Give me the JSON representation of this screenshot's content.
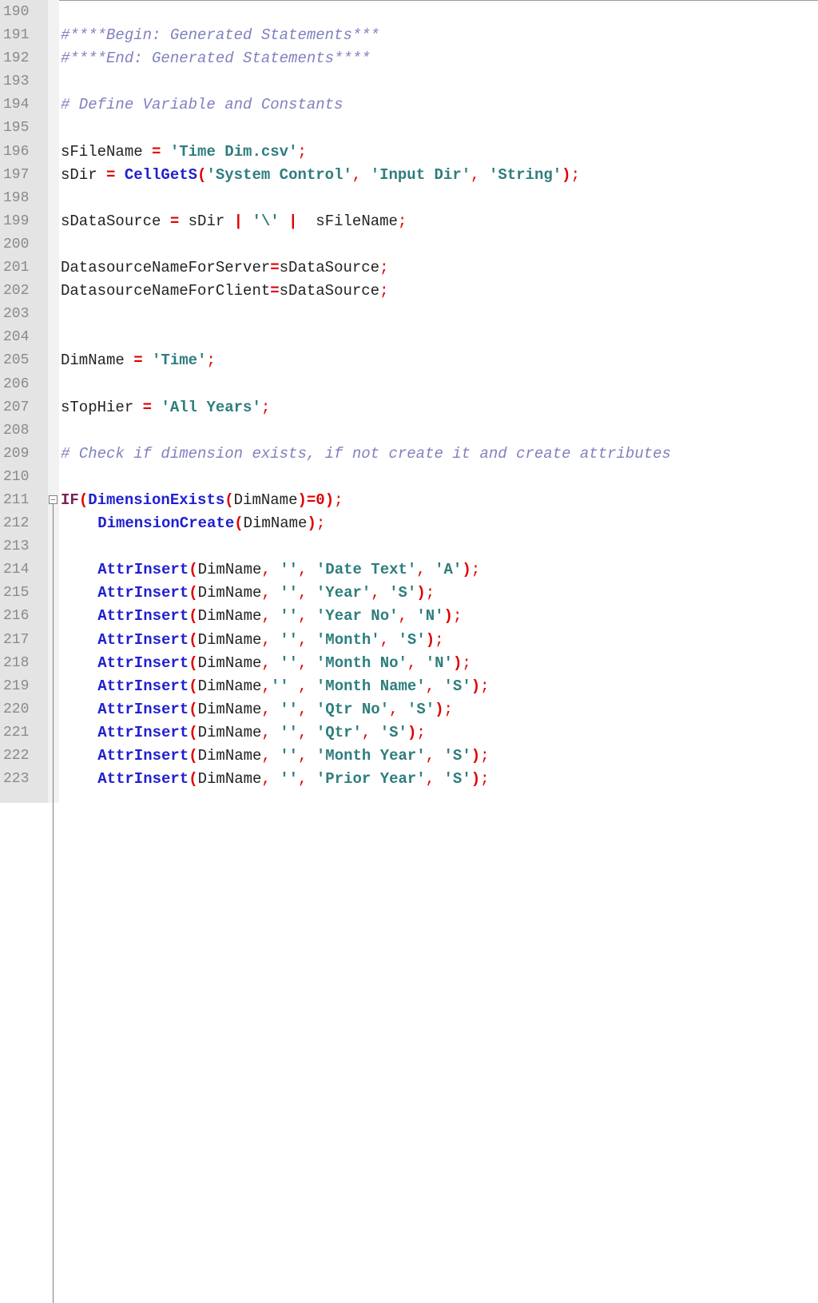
{
  "editor": {
    "lines": [
      {
        "num": "190",
        "indent": 0,
        "tokens": []
      },
      {
        "num": "191",
        "indent": 0,
        "tokens": [
          {
            "t": "comment",
            "v": "#****Begin: Generated Statements***"
          }
        ]
      },
      {
        "num": "192",
        "indent": 0,
        "tokens": [
          {
            "t": "comment",
            "v": "#****End: Generated Statements****"
          }
        ]
      },
      {
        "num": "193",
        "indent": 0,
        "tokens": []
      },
      {
        "num": "194",
        "indent": 0,
        "tokens": [
          {
            "t": "comment",
            "v": "# Define Variable and Constants"
          }
        ]
      },
      {
        "num": "195",
        "indent": 0,
        "tokens": []
      },
      {
        "num": "196",
        "indent": 0,
        "tokens": [
          {
            "t": "ident",
            "v": "sFileName "
          },
          {
            "t": "op",
            "v": "="
          },
          {
            "t": "space",
            "v": " "
          },
          {
            "t": "str",
            "v": "'Time Dim.csv'"
          },
          {
            "t": "punct",
            "v": ";"
          }
        ]
      },
      {
        "num": "197",
        "indent": 0,
        "tokens": [
          {
            "t": "ident",
            "v": "sDir "
          },
          {
            "t": "op",
            "v": "="
          },
          {
            "t": "space",
            "v": " "
          },
          {
            "t": "func",
            "v": "CellGetS"
          },
          {
            "t": "op",
            "v": "("
          },
          {
            "t": "str",
            "v": "'System Control'"
          },
          {
            "t": "punct",
            "v": ", "
          },
          {
            "t": "str",
            "v": "'Input Dir'"
          },
          {
            "t": "punct",
            "v": ", "
          },
          {
            "t": "str",
            "v": "'String'"
          },
          {
            "t": "op",
            "v": ")"
          },
          {
            "t": "punct",
            "v": ";"
          }
        ]
      },
      {
        "num": "198",
        "indent": 0,
        "tokens": []
      },
      {
        "num": "199",
        "indent": 0,
        "tokens": [
          {
            "t": "ident",
            "v": "sDataSource "
          },
          {
            "t": "op",
            "v": "="
          },
          {
            "t": "ident",
            "v": " sDir "
          },
          {
            "t": "op",
            "v": "|"
          },
          {
            "t": "space",
            "v": " "
          },
          {
            "t": "str",
            "v": "'\\'"
          },
          {
            "t": "space",
            "v": " "
          },
          {
            "t": "op",
            "v": "|"
          },
          {
            "t": "ident",
            "v": "  sFileName"
          },
          {
            "t": "punct",
            "v": ";"
          }
        ]
      },
      {
        "num": "200",
        "indent": 0,
        "tokens": []
      },
      {
        "num": "201",
        "indent": 0,
        "tokens": [
          {
            "t": "ident",
            "v": "DatasourceNameForServer"
          },
          {
            "t": "op",
            "v": "="
          },
          {
            "t": "ident",
            "v": "sDataSource"
          },
          {
            "t": "punct",
            "v": ";"
          }
        ]
      },
      {
        "num": "202",
        "indent": 0,
        "tokens": [
          {
            "t": "ident",
            "v": "DatasourceNameForClient"
          },
          {
            "t": "op",
            "v": "="
          },
          {
            "t": "ident",
            "v": "sDataSource"
          },
          {
            "t": "punct",
            "v": ";"
          }
        ]
      },
      {
        "num": "203",
        "indent": 0,
        "tokens": []
      },
      {
        "num": "204",
        "indent": 0,
        "tokens": []
      },
      {
        "num": "205",
        "indent": 0,
        "tokens": [
          {
            "t": "ident",
            "v": "DimName "
          },
          {
            "t": "op",
            "v": "="
          },
          {
            "t": "space",
            "v": " "
          },
          {
            "t": "str",
            "v": "'Time'"
          },
          {
            "t": "punct",
            "v": ";"
          }
        ]
      },
      {
        "num": "206",
        "indent": 0,
        "tokens": []
      },
      {
        "num": "207",
        "indent": 0,
        "tokens": [
          {
            "t": "ident",
            "v": "sTopHier "
          },
          {
            "t": "op",
            "v": "="
          },
          {
            "t": "space",
            "v": " "
          },
          {
            "t": "str",
            "v": "'All Years'"
          },
          {
            "t": "punct",
            "v": ";"
          }
        ]
      },
      {
        "num": "208",
        "indent": 0,
        "tokens": []
      },
      {
        "num": "209",
        "indent": 0,
        "tokens": [
          {
            "t": "comment",
            "v": "# Check if dimension exists, if not create it and create attributes"
          }
        ]
      },
      {
        "num": "210",
        "indent": 0,
        "tokens": []
      },
      {
        "num": "211",
        "indent": 0,
        "fold": true,
        "tokens": [
          {
            "t": "kw",
            "v": "IF"
          },
          {
            "t": "op",
            "v": "("
          },
          {
            "t": "func",
            "v": "DimensionExists"
          },
          {
            "t": "op",
            "v": "("
          },
          {
            "t": "ident",
            "v": "DimName"
          },
          {
            "t": "op",
            "v": ")=0)"
          },
          {
            "t": "punct",
            "v": ";"
          }
        ]
      },
      {
        "num": "212",
        "indent": 4,
        "tokens": [
          {
            "t": "func",
            "v": "DimensionCreate"
          },
          {
            "t": "op",
            "v": "("
          },
          {
            "t": "ident",
            "v": "DimName"
          },
          {
            "t": "op",
            "v": ")"
          },
          {
            "t": "punct",
            "v": ";"
          }
        ]
      },
      {
        "num": "213",
        "indent": 0,
        "tokens": []
      },
      {
        "num": "214",
        "indent": 4,
        "tokens": [
          {
            "t": "func",
            "v": "AttrInsert"
          },
          {
            "t": "op",
            "v": "("
          },
          {
            "t": "ident",
            "v": "DimName"
          },
          {
            "t": "punct",
            "v": ", "
          },
          {
            "t": "str",
            "v": "''"
          },
          {
            "t": "punct",
            "v": ", "
          },
          {
            "t": "str",
            "v": "'Date Text'"
          },
          {
            "t": "punct",
            "v": ", "
          },
          {
            "t": "str",
            "v": "'A'"
          },
          {
            "t": "op",
            "v": ")"
          },
          {
            "t": "punct",
            "v": ";"
          }
        ]
      },
      {
        "num": "215",
        "indent": 4,
        "tokens": [
          {
            "t": "func",
            "v": "AttrInsert"
          },
          {
            "t": "op",
            "v": "("
          },
          {
            "t": "ident",
            "v": "DimName"
          },
          {
            "t": "punct",
            "v": ", "
          },
          {
            "t": "str",
            "v": "''"
          },
          {
            "t": "punct",
            "v": ", "
          },
          {
            "t": "str",
            "v": "'Year'"
          },
          {
            "t": "punct",
            "v": ", "
          },
          {
            "t": "str",
            "v": "'S'"
          },
          {
            "t": "op",
            "v": ")"
          },
          {
            "t": "punct",
            "v": ";"
          }
        ]
      },
      {
        "num": "216",
        "indent": 4,
        "tokens": [
          {
            "t": "func",
            "v": "AttrInsert"
          },
          {
            "t": "op",
            "v": "("
          },
          {
            "t": "ident",
            "v": "DimName"
          },
          {
            "t": "punct",
            "v": ", "
          },
          {
            "t": "str",
            "v": "''"
          },
          {
            "t": "punct",
            "v": ", "
          },
          {
            "t": "str",
            "v": "'Year No'"
          },
          {
            "t": "punct",
            "v": ", "
          },
          {
            "t": "str",
            "v": "'N'"
          },
          {
            "t": "op",
            "v": ")"
          },
          {
            "t": "punct",
            "v": ";"
          }
        ]
      },
      {
        "num": "217",
        "indent": 4,
        "tokens": [
          {
            "t": "func",
            "v": "AttrInsert"
          },
          {
            "t": "op",
            "v": "("
          },
          {
            "t": "ident",
            "v": "DimName"
          },
          {
            "t": "punct",
            "v": ", "
          },
          {
            "t": "str",
            "v": "''"
          },
          {
            "t": "punct",
            "v": ", "
          },
          {
            "t": "str",
            "v": "'Month'"
          },
          {
            "t": "punct",
            "v": ", "
          },
          {
            "t": "str",
            "v": "'S'"
          },
          {
            "t": "op",
            "v": ")"
          },
          {
            "t": "punct",
            "v": ";"
          }
        ]
      },
      {
        "num": "218",
        "indent": 4,
        "tokens": [
          {
            "t": "func",
            "v": "AttrInsert"
          },
          {
            "t": "op",
            "v": "("
          },
          {
            "t": "ident",
            "v": "DimName"
          },
          {
            "t": "punct",
            "v": ", "
          },
          {
            "t": "str",
            "v": "''"
          },
          {
            "t": "punct",
            "v": ", "
          },
          {
            "t": "str",
            "v": "'Month No'"
          },
          {
            "t": "punct",
            "v": ", "
          },
          {
            "t": "str",
            "v": "'N'"
          },
          {
            "t": "op",
            "v": ")"
          },
          {
            "t": "punct",
            "v": ";"
          }
        ]
      },
      {
        "num": "219",
        "indent": 4,
        "tokens": [
          {
            "t": "func",
            "v": "AttrInsert"
          },
          {
            "t": "op",
            "v": "("
          },
          {
            "t": "ident",
            "v": "DimName"
          },
          {
            "t": "punct",
            "v": ","
          },
          {
            "t": "str",
            "v": "''"
          },
          {
            "t": "punct",
            "v": " , "
          },
          {
            "t": "str",
            "v": "'Month Name'"
          },
          {
            "t": "punct",
            "v": ", "
          },
          {
            "t": "str",
            "v": "'S'"
          },
          {
            "t": "op",
            "v": ")"
          },
          {
            "t": "punct",
            "v": ";"
          }
        ]
      },
      {
        "num": "220",
        "indent": 4,
        "tokens": [
          {
            "t": "func",
            "v": "AttrInsert"
          },
          {
            "t": "op",
            "v": "("
          },
          {
            "t": "ident",
            "v": "DimName"
          },
          {
            "t": "punct",
            "v": ", "
          },
          {
            "t": "str",
            "v": "''"
          },
          {
            "t": "punct",
            "v": ", "
          },
          {
            "t": "str",
            "v": "'Qtr No'"
          },
          {
            "t": "punct",
            "v": ", "
          },
          {
            "t": "str",
            "v": "'S'"
          },
          {
            "t": "op",
            "v": ")"
          },
          {
            "t": "punct",
            "v": ";"
          }
        ]
      },
      {
        "num": "221",
        "indent": 4,
        "tokens": [
          {
            "t": "func",
            "v": "AttrInsert"
          },
          {
            "t": "op",
            "v": "("
          },
          {
            "t": "ident",
            "v": "DimName"
          },
          {
            "t": "punct",
            "v": ", "
          },
          {
            "t": "str",
            "v": "''"
          },
          {
            "t": "punct",
            "v": ", "
          },
          {
            "t": "str",
            "v": "'Qtr'"
          },
          {
            "t": "punct",
            "v": ", "
          },
          {
            "t": "str",
            "v": "'S'"
          },
          {
            "t": "op",
            "v": ")"
          },
          {
            "t": "punct",
            "v": ";"
          }
        ]
      },
      {
        "num": "222",
        "indent": 4,
        "tokens": [
          {
            "t": "func",
            "v": "AttrInsert"
          },
          {
            "t": "op",
            "v": "("
          },
          {
            "t": "ident",
            "v": "DimName"
          },
          {
            "t": "punct",
            "v": ", "
          },
          {
            "t": "str",
            "v": "''"
          },
          {
            "t": "punct",
            "v": ", "
          },
          {
            "t": "str",
            "v": "'Month Year'"
          },
          {
            "t": "punct",
            "v": ", "
          },
          {
            "t": "str",
            "v": "'S'"
          },
          {
            "t": "op",
            "v": ")"
          },
          {
            "t": "punct",
            "v": ";"
          }
        ]
      },
      {
        "num": "223",
        "indent": 4,
        "tokens": [
          {
            "t": "func",
            "v": "AttrInsert"
          },
          {
            "t": "op",
            "v": "("
          },
          {
            "t": "ident",
            "v": "DimName"
          },
          {
            "t": "punct",
            "v": ", "
          },
          {
            "t": "str",
            "v": "''"
          },
          {
            "t": "punct",
            "v": ", "
          },
          {
            "t": "str",
            "v": "'Prior Year'"
          },
          {
            "t": "punct",
            "v": ", "
          },
          {
            "t": "str",
            "v": "'S'"
          },
          {
            "t": "op",
            "v": ")"
          },
          {
            "t": "punct",
            "v": ";"
          }
        ]
      }
    ]
  },
  "colors": {
    "comment": "#8080c0",
    "operator": "#e00000",
    "string": "#2e7d7d",
    "function": "#1f1fd0",
    "keyword": "#7a1f5a",
    "gutter_bg": "#e4e4e4",
    "line_number": "#8a8a8a"
  }
}
